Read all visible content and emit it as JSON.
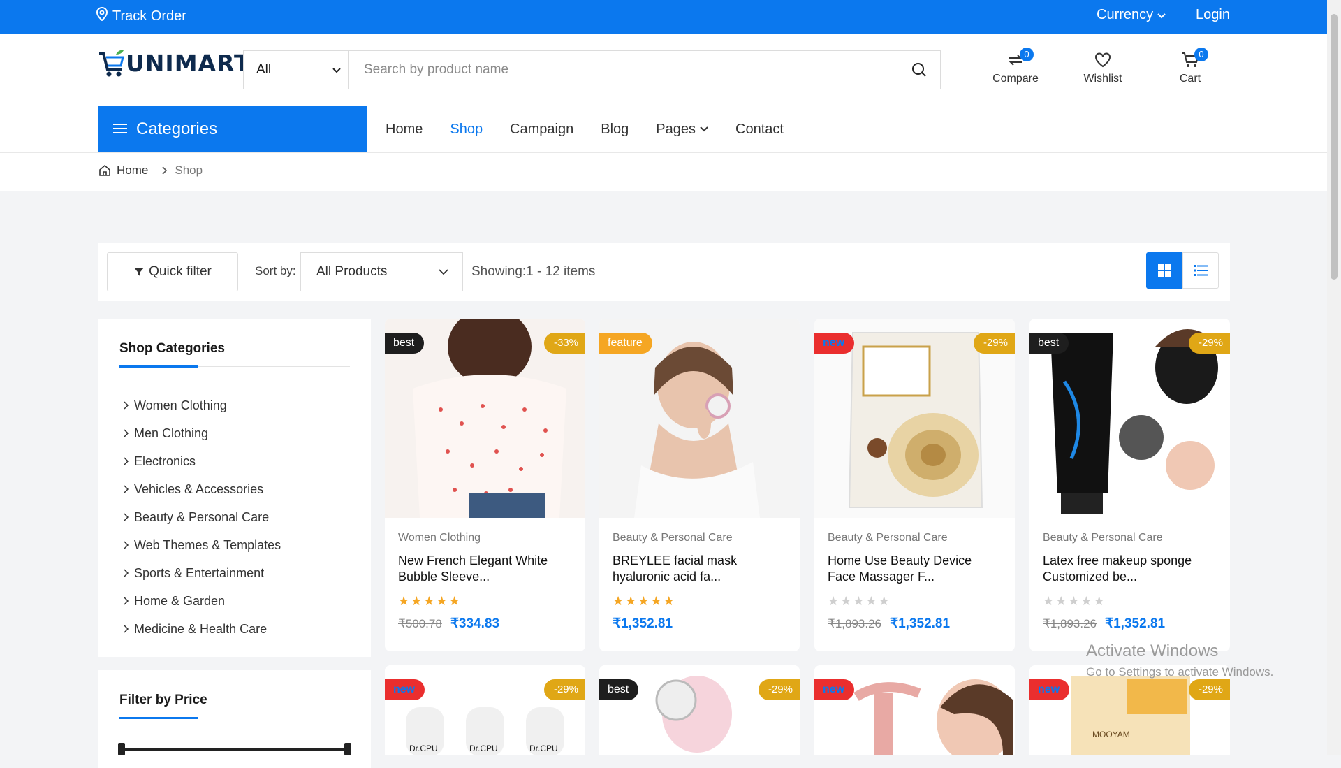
{
  "topbar": {
    "track_order": "Track Order",
    "currency": "Currency",
    "login": "Login"
  },
  "brand": {
    "name": "UNIMART"
  },
  "search": {
    "category": "All",
    "placeholder": "Search by product name"
  },
  "header_icons": {
    "compare": {
      "label": "Compare",
      "count": "0"
    },
    "wishlist": {
      "label": "Wishlist"
    },
    "cart": {
      "label": "Cart",
      "count": "0"
    }
  },
  "nav": {
    "categories_label": "Categories",
    "links": [
      "Home",
      "Shop",
      "Campaign",
      "Blog",
      "Pages",
      "Contact"
    ],
    "active": "Shop"
  },
  "breadcrumb": {
    "home": "Home",
    "current": "Shop"
  },
  "toolbar": {
    "quick_filter": "Quick filter",
    "sort_label": "Sort by:",
    "sort_value": "All Products",
    "showing": "Showing:1 - 12 items"
  },
  "sidebar": {
    "categories_title": "Shop Categories",
    "categories": [
      "Women Clothing",
      "Men Clothing",
      "Electronics",
      "Vehicles & Accessories",
      "Beauty & Personal Care",
      "Web Themes & Templates",
      "Sports & Entertainment",
      "Home & Garden",
      "Medicine & Health Care"
    ],
    "price_title": "Filter by Price"
  },
  "products": [
    {
      "tag": "best",
      "discount": "-33%",
      "category": "Women Clothing",
      "name_line1": "New French Elegant White",
      "name_line2": "Bubble Sleeve...",
      "rating": 5,
      "old_price": "₹500.78",
      "price": "₹334.83"
    },
    {
      "tag": "feature",
      "discount": "",
      "category": "Beauty & Personal Care",
      "name_line1": "BREYLEE facial mask",
      "name_line2": "hyaluronic acid fa...",
      "rating": 5,
      "old_price": "",
      "price": "₹1,352.81"
    },
    {
      "tag": "new",
      "discount": "-29%",
      "category": "Beauty & Personal Care",
      "name_line1": "Home Use Beauty Device",
      "name_line2": "Face Massager F...",
      "rating": 0,
      "old_price": "₹1,893.26",
      "price": "₹1,352.81"
    },
    {
      "tag": "best",
      "discount": "-29%",
      "category": "Beauty & Personal Care",
      "name_line1": "Latex free makeup sponge",
      "name_line2": "Customized be...",
      "rating": 0,
      "old_price": "₹1,893.26",
      "price": "₹1,352.81"
    }
  ],
  "products_row2": [
    {
      "tag": "new",
      "discount": "-29%",
      "image_text": "Dr.CPU"
    },
    {
      "tag": "best",
      "discount": "-29%"
    },
    {
      "tag": "new",
      "discount": ""
    },
    {
      "tag": "new",
      "discount": "-29%",
      "image_text": "MOOYAM"
    }
  ],
  "watermark": {
    "line1": "Activate Windows",
    "line2": "Go to Settings to activate Windows."
  },
  "colors": {
    "primary": "#0b78ee",
    "badge_best": "#1e1e1e",
    "badge_feature": "#f5a623",
    "badge_new": "#ea2e2e",
    "discount": "#e0a716",
    "star": "#f5a623"
  }
}
